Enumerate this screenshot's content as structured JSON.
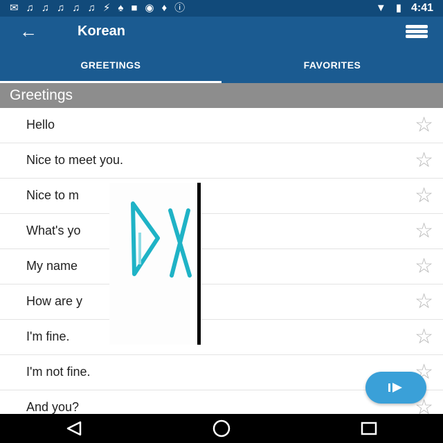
{
  "status_bar": {
    "time": "4:41",
    "icons": [
      "chat-icon",
      "music-icon",
      "music-icon",
      "music-icon",
      "music-icon",
      "music-icon",
      "usb-icon",
      "shirt-icon",
      "facebook-icon",
      "headset-icon",
      "fox-icon",
      "info-icon",
      "wifi-icon",
      "battery-icon"
    ]
  },
  "app_bar": {
    "title": "Korean"
  },
  "tabs": [
    {
      "label": "GREETINGS",
      "active": true
    },
    {
      "label": "FAVORITES",
      "active": false
    }
  ],
  "section": {
    "title": "Greetings"
  },
  "phrases": [
    {
      "label": "Hello"
    },
    {
      "label": "Nice to meet you."
    },
    {
      "label": "Nice to m"
    },
    {
      "label": "What's yo"
    },
    {
      "label": "My name"
    },
    {
      "label": "How are y"
    },
    {
      "label": "I'm fine."
    },
    {
      "label": "I'm not fine."
    },
    {
      "label": "And you?"
    }
  ],
  "colors": {
    "status_bar": "#114a7a",
    "app_bar": "#1b5b91",
    "section_header": "#8d8d8d",
    "fab": "#3aa0d8",
    "star": "#b8b8b8"
  }
}
